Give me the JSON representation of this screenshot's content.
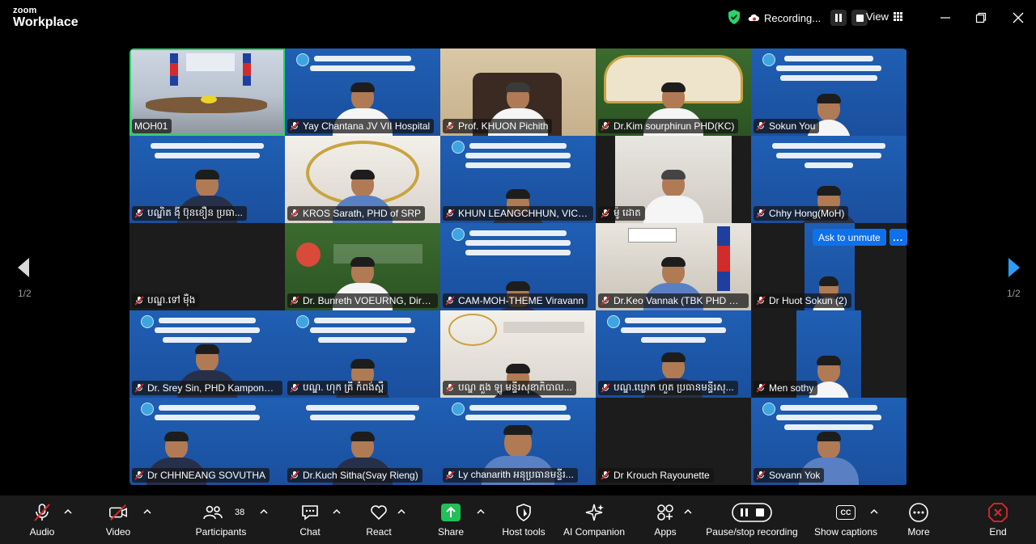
{
  "app": {
    "brand_top": "zoom",
    "brand_bottom": "Workplace"
  },
  "topbar": {
    "recording_label": "Recording...",
    "view_label": "View"
  },
  "nav": {
    "page_left": "1/2",
    "page_right": "1/2"
  },
  "tiles": [
    {
      "name": "MOH01",
      "muted": false
    },
    {
      "name": "Yay Chantana JV VII Hospital",
      "muted": true
    },
    {
      "name": "Prof. KHUON Pichith",
      "muted": true
    },
    {
      "name": "Dr.Kim sourphirun PHD(KC)",
      "muted": true
    },
    {
      "name": "Sokun You",
      "muted": true
    },
    {
      "name": "បណ្ឌិត ង៉ី ប៊ុនខឿន ប្រធា...",
      "muted": true
    },
    {
      "name": "KROS Sarath, PHD of SRP",
      "muted": true
    },
    {
      "name": "KHUN LEANGCHHUN, VICE-...",
      "muted": true
    },
    {
      "name": "ម៉ូ ដោត",
      "muted": true
    },
    {
      "name": "Chhy Hong(MoH)",
      "muted": true
    },
    {
      "name": "បណ្ឌ.ទៅ ម៉ឺង",
      "muted": true
    },
    {
      "name": "Dr. Bunreth VOEURNG, Dire...",
      "muted": true
    },
    {
      "name": "CAM-MOH-THEME Viravann",
      "muted": true
    },
    {
      "name": "Dr.Keo Vannak (TBK PHD Dir...",
      "muted": true
    },
    {
      "name": "Dr Huot Sokun (2)",
      "muted": true
    },
    {
      "name": "Dr. Srey Sin, PHD Kampong ...",
      "muted": true
    },
    {
      "name": "បណ្ឌ. ហុក គ្រី កំពង់ស្ពឺ",
      "muted": true
    },
    {
      "name": "បណ្ឌ គួង ឡូ មន្ទីរសុខាភិបាល...",
      "muted": true
    },
    {
      "name": "បណ្ឌ.ឃ្លោក ហួត ប្រធានមន្ទីរសុ...",
      "muted": true
    },
    {
      "name": "Men sothy",
      "muted": true
    },
    {
      "name": "Dr CHHNEANG SOVUTHA",
      "muted": true
    },
    {
      "name": "Dr.Kuch Sitha(Svay Rieng)",
      "muted": true
    },
    {
      "name": "Ly chanarith អនុប្រធានមន្ទីរ...",
      "muted": true
    },
    {
      "name": "Dr Krouch Rayounette",
      "muted": true
    },
    {
      "name": "Sovann Yok",
      "muted": true
    }
  ],
  "ask_unmute": {
    "label": "Ask to unmute",
    "more": "..."
  },
  "toolbar": {
    "audio": "Audio",
    "video": "Video",
    "participants": "Participants",
    "participants_count": "38",
    "chat": "Chat",
    "react": "React",
    "share": "Share",
    "host_tools": "Host tools",
    "ai_companion": "AI Companion",
    "apps": "Apps",
    "pause_recording": "Pause/stop recording",
    "show_captions": "Show captions",
    "cc": "CC",
    "more": "More",
    "end": "End"
  },
  "colors": {
    "accent_green": "#2bd36a",
    "share_green": "#21c058",
    "unmute_blue": "#0e71eb",
    "end_red": "#e02828",
    "mute_red": "#e02828"
  }
}
